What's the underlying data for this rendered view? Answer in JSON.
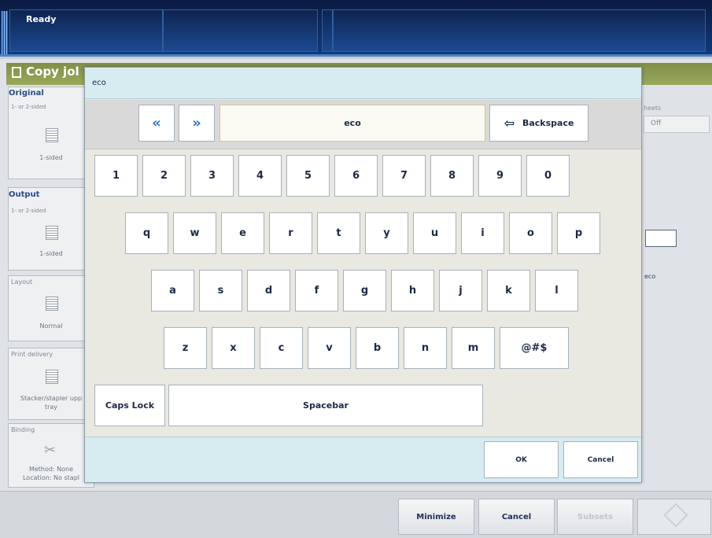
{
  "status": {
    "text": "Ready"
  },
  "copy_job": {
    "title": "Copy jol",
    "original": {
      "heading": "Original",
      "sub": "1- or 2-sided",
      "value": "1-sided"
    },
    "output": {
      "heading": "Output",
      "sub": "1- or 2-sided",
      "value": "1-sided"
    },
    "layout": {
      "label": "Layout",
      "value": "Normal"
    },
    "print_delivery": {
      "label": "Print delivery",
      "value_line1": "Stacker/stapler upp",
      "value_line2": "tray"
    },
    "binding": {
      "label": "Binding",
      "value_line1": "Method: None",
      "value_line2": "Location: No stapl"
    },
    "sheets": {
      "label": "heets",
      "value": "Off"
    },
    "side_value": "eco"
  },
  "dialog": {
    "title": "eco",
    "input_value": "eco",
    "prev_icon": "double-chevron-left-icon",
    "next_icon": "double-chevron-right-icon",
    "backspace_label": "Backspace",
    "keys_row1": [
      "1",
      "2",
      "3",
      "4",
      "5",
      "6",
      "7",
      "8",
      "9",
      "0"
    ],
    "keys_row2": [
      "q",
      "w",
      "e",
      "r",
      "t",
      "y",
      "u",
      "i",
      "o",
      "p"
    ],
    "keys_row3": [
      "a",
      "s",
      "d",
      "f",
      "g",
      "h",
      "j",
      "k",
      "l"
    ],
    "keys_row4": [
      "z",
      "x",
      "c",
      "v",
      "b",
      "n",
      "m",
      "@#$"
    ],
    "caps_label": "Caps Lock",
    "space_label": "Spacebar",
    "ok_label": "OK",
    "cancel_label": "Cancel"
  },
  "bottom_bar": {
    "minimize_label": "Minimize",
    "cancel_label": "Cancel",
    "subsets_label": "Subsets"
  }
}
